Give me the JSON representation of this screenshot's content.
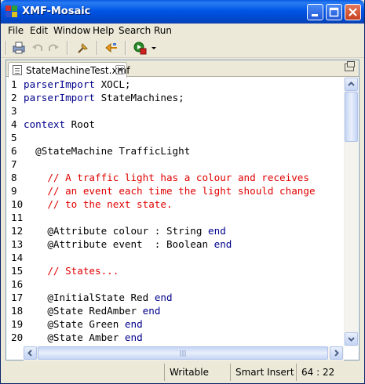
{
  "window": {
    "title": "XMF-Mosaic",
    "icon": "xmf-mosaic-app-icon",
    "controls": [
      "minimize-icon",
      "maximize-icon",
      "close-icon"
    ]
  },
  "menu": {
    "items": [
      {
        "label": "File"
      },
      {
        "label": "Edit"
      },
      {
        "label": "Window"
      },
      {
        "label": "Help"
      },
      {
        "label": "Search"
      },
      {
        "label": "Run"
      }
    ]
  },
  "toolbar": {
    "icons": [
      "print-icon",
      "undo-icon",
      "redo-icon",
      "pin-icon",
      "back-icon",
      "run-icon",
      "dropdown-arrow-icon"
    ]
  },
  "editor": {
    "tab": {
      "label": "StateMachineTest.xmf",
      "close_glyph": "✕"
    },
    "lines": [
      {
        "num": "1",
        "segments": [
          {
            "t": "kw",
            "v": "parserImport"
          },
          {
            "t": "tx",
            "v": " XOCL;"
          }
        ]
      },
      {
        "num": "2",
        "segments": [
          {
            "t": "kw",
            "v": "parserImport"
          },
          {
            "t": "tx",
            "v": " StateMachines;"
          }
        ]
      },
      {
        "num": "3",
        "segments": []
      },
      {
        "num": "4",
        "segments": [
          {
            "t": "kw",
            "v": "context"
          },
          {
            "t": "tx",
            "v": " Root"
          }
        ]
      },
      {
        "num": "5",
        "segments": []
      },
      {
        "num": "6",
        "segments": [
          {
            "t": "tx",
            "v": "  @StateMachine TrafficLight"
          }
        ]
      },
      {
        "num": "7",
        "segments": []
      },
      {
        "num": "8",
        "segments": [
          {
            "t": "cm",
            "v": "    // A traffic light has a colour and receives"
          }
        ]
      },
      {
        "num": "9",
        "segments": [
          {
            "t": "cm",
            "v": "    // an event each time the light should change"
          }
        ]
      },
      {
        "num": "10",
        "segments": [
          {
            "t": "cm",
            "v": "    // to the next state."
          }
        ]
      },
      {
        "num": "11",
        "segments": []
      },
      {
        "num": "12",
        "segments": [
          {
            "t": "tx",
            "v": "    @Attribute colour : String "
          },
          {
            "t": "kw",
            "v": "end"
          }
        ]
      },
      {
        "num": "13",
        "segments": [
          {
            "t": "tx",
            "v": "    @Attribute event  : Boolean "
          },
          {
            "t": "kw",
            "v": "end"
          }
        ]
      },
      {
        "num": "14",
        "segments": []
      },
      {
        "num": "15",
        "segments": [
          {
            "t": "cm",
            "v": "    // States..."
          }
        ]
      },
      {
        "num": "16",
        "segments": []
      },
      {
        "num": "17",
        "segments": [
          {
            "t": "tx",
            "v": "    @InitialState Red "
          },
          {
            "t": "kw",
            "v": "end"
          }
        ]
      },
      {
        "num": "18",
        "segments": [
          {
            "t": "tx",
            "v": "    @State RedAmber "
          },
          {
            "t": "kw",
            "v": "end"
          }
        ]
      },
      {
        "num": "19",
        "segments": [
          {
            "t": "tx",
            "v": "    @State Green "
          },
          {
            "t": "kw",
            "v": "end"
          }
        ]
      },
      {
        "num": "20",
        "segments": [
          {
            "t": "tx",
            "v": "    @State Amber "
          },
          {
            "t": "kw",
            "v": "end"
          }
        ]
      }
    ],
    "colors": {
      "keyword": "#00008b",
      "comment": "#e00000",
      "text": "#000000"
    }
  },
  "status": {
    "mode": "Writable",
    "insert": "Smart Insert",
    "position": "64 : 22"
  }
}
